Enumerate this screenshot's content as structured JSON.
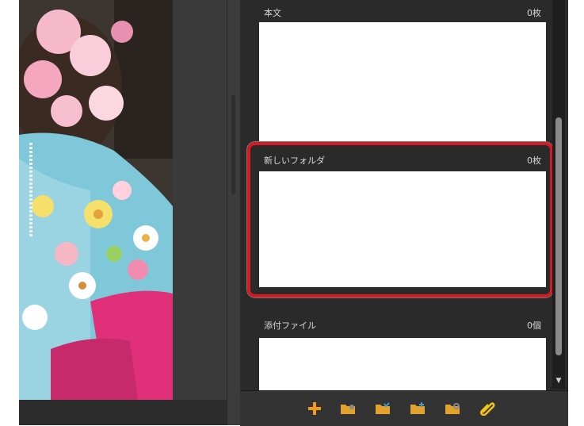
{
  "sections": {
    "honbun": {
      "title": "本文",
      "count": "0枚"
    },
    "new_folder": {
      "title": "新しいフォルダ",
      "count": "0枚"
    },
    "attachments": {
      "title": "添付ファイル",
      "count": "0個"
    }
  },
  "colors": {
    "highlight": "#d71a21",
    "accent_orange": "#f39a1e",
    "panel_dark": "#2a2a2a"
  },
  "toolbar": {
    "icons": [
      "plus-icon",
      "folder-image-icon",
      "folder-check-icon",
      "folder-add-icon",
      "folder-settings-icon",
      "paperclip-icon"
    ]
  }
}
